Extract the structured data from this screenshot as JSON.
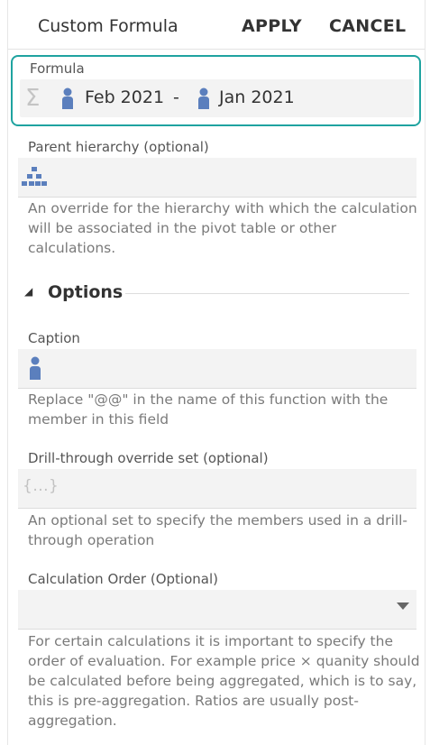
{
  "header": {
    "title": "Custom Formula",
    "apply_label": "APPLY",
    "cancel_label": "CANCEL"
  },
  "formula": {
    "label": "Formula",
    "sigma_icon": "sigma-icon",
    "member_a": "Feb 2021",
    "operator": "-",
    "member_b": "Jan 2021",
    "member_icon": "member-icon",
    "highlight_color": "#1fa3a0"
  },
  "parent_hierarchy": {
    "label": "Parent hierarchy (optional)",
    "icon": "hierarchy-icon",
    "help": "An override for the hierarchy with which the calculation will be associated in the pivot table or other calculations."
  },
  "options": {
    "heading": "Options",
    "expanded": true
  },
  "caption": {
    "label": "Caption",
    "icon": "member-icon",
    "help": "Replace \"@@\" in the name of this function with the member in this field"
  },
  "drill_through": {
    "label": "Drill-through override set (optional)",
    "icon_text": "{...}",
    "help": "An optional set to specify the members used in a drill-through operation"
  },
  "calculation_order": {
    "label": "Calculation Order (Optional)",
    "help": "For certain calculations it is important to specify the order of evaluation. For example price × quanity should be calculated before being aggregated, which is to say, this is pre-aggregation. Ratios are usually post-aggregation."
  },
  "colors": {
    "icon_blue": "#5b7fbd",
    "help_text": "#7a7a7a",
    "field_bg": "#f3f3f3"
  }
}
